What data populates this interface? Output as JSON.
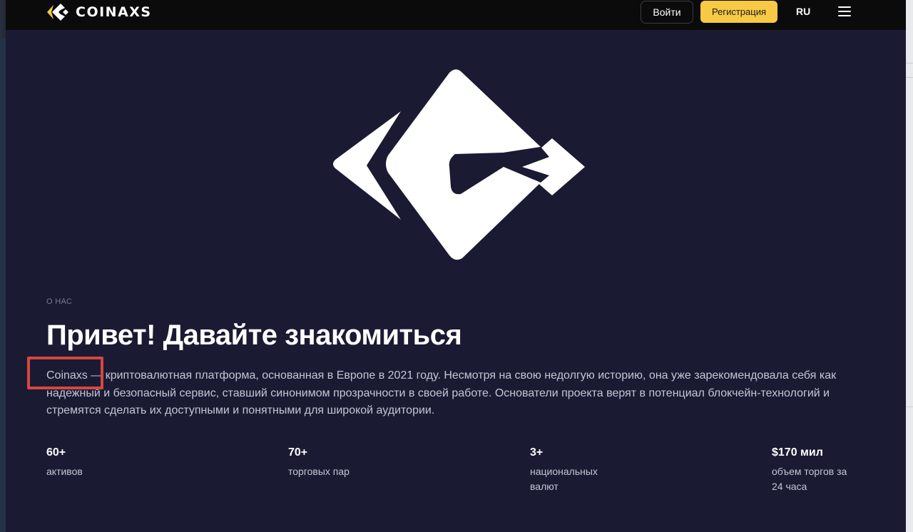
{
  "header": {
    "brand": "COINAXS",
    "login_label": "Войти",
    "register_label": "Регистрация",
    "lang_label": "RU",
    "menu_icon": "hamburger-icon",
    "accent_color": "#f7c944"
  },
  "about": {
    "eyebrow": "О НАС",
    "title": "Привет! Давайте знакомиться",
    "description": "Coinaxs — криптовалютная платформа, основанная в Европе в 2021 году. Несмотря на свою недолгую историю, она уже зарекомендовала себя как надежный и безопасный сервис, ставший синонимом прозрачности в своей работе. Основатели проекта верят в потенциал блокчейн-технологий и стремятся сделать их доступными и понятными для широкой аудитории."
  },
  "stats": [
    {
      "value": "60+",
      "label_lines": [
        "активов"
      ]
    },
    {
      "value": "70+",
      "label_lines": [
        "торговых пар"
      ]
    },
    {
      "value": "3+",
      "label_lines": [
        "национальных",
        "валют"
      ]
    },
    {
      "value": "$170 мил",
      "label_lines": [
        "объем торгов за",
        "24 часа"
      ]
    }
  ],
  "colors": {
    "page_bg": "#1a1a33",
    "header_bg": "#0b0b0c",
    "highlight_box": "#d6473f"
  }
}
